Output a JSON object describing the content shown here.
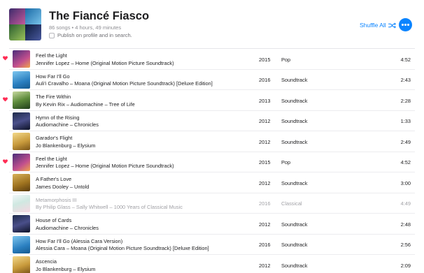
{
  "playlist": {
    "title": "The Fiancé Fiasco",
    "meta": "86 songs • 4 hours, 49 minutes",
    "publish_label": "Publish on profile and in search.",
    "shuffle_label": "Shuffle All",
    "accent_color": "#0a84ff"
  },
  "tracks": [
    {
      "name": "Feel the Light",
      "artist": "Jennifer Lopez – Home (Original Motion Picture Soundtrack)",
      "year": "2015",
      "genre": "Pop",
      "duration": "4:52",
      "loved": true,
      "art": "t-home",
      "dim": false
    },
    {
      "name": "How Far I'll Go",
      "artist": "Auli'i Cravalho – Moana (Original Motion Picture Soundtrack) [Deluxe Edition]",
      "year": "2016",
      "genre": "Soundtrack",
      "duration": "2:43",
      "loved": false,
      "art": "t-moana",
      "dim": false
    },
    {
      "name": "The Fire Within",
      "artist": "By Kevin Rix – Audiomachine – Tree of Life",
      "year": "2013",
      "genre": "Soundtrack",
      "duration": "2:28",
      "loved": true,
      "art": "t-fire",
      "dim": false
    },
    {
      "name": "Hymn of the Rising",
      "artist": "Audiomachine – Chronicles",
      "year": "2012",
      "genre": "Soundtrack",
      "duration": "1:33",
      "loved": false,
      "art": "t-chron",
      "dim": false
    },
    {
      "name": "Garador's Flight",
      "artist": "Jo Blankenburg – Elysium",
      "year": "2012",
      "genre": "Soundtrack",
      "duration": "2:49",
      "loved": false,
      "art": "t-elys",
      "dim": false
    },
    {
      "name": "Feel the Light",
      "artist": "Jennifer Lopez – Home (Original Motion Picture Soundtrack)",
      "year": "2015",
      "genre": "Pop",
      "duration": "4:52",
      "loved": true,
      "art": "t-home",
      "dim": false
    },
    {
      "name": "A Father's Love",
      "artist": "James Dooley – Untold",
      "year": "2012",
      "genre": "Soundtrack",
      "duration": "3:00",
      "loved": false,
      "art": "t-untold",
      "dim": false
    },
    {
      "name": "Metamorphosis III",
      "artist": "By Philip Glass – Sally Whitwell – 1000 Years of Classical Music",
      "year": "2016",
      "genre": "Classical",
      "duration": "4:49",
      "loved": false,
      "art": "t-glass",
      "dim": true
    },
    {
      "name": "House of Cards",
      "artist": "Audiomachine – Chronicles",
      "year": "2012",
      "genre": "Soundtrack",
      "duration": "2:48",
      "loved": false,
      "art": "t-chron",
      "dim": false
    },
    {
      "name": "How Far I'll Go (Alessia Cara Version)",
      "artist": "Alessia Cara – Moana (Original Motion Picture Soundtrack) [Deluxe Edition]",
      "year": "2016",
      "genre": "Soundtrack",
      "duration": "2:56",
      "loved": false,
      "art": "t-moana",
      "dim": false
    },
    {
      "name": "Ascencia",
      "artist": "Jo Blankenburg – Elysium",
      "year": "2012",
      "genre": "Soundtrack",
      "duration": "2:09",
      "loved": false,
      "art": "t-elys",
      "dim": false
    }
  ],
  "icons": {
    "heart": "heart-icon",
    "shuffle": "shuffle-icon",
    "more": "more-icon",
    "checkbox": "checkbox-icon"
  },
  "colors": {
    "heart": "#ff2d55",
    "dim_text": "#a1a1a6"
  }
}
